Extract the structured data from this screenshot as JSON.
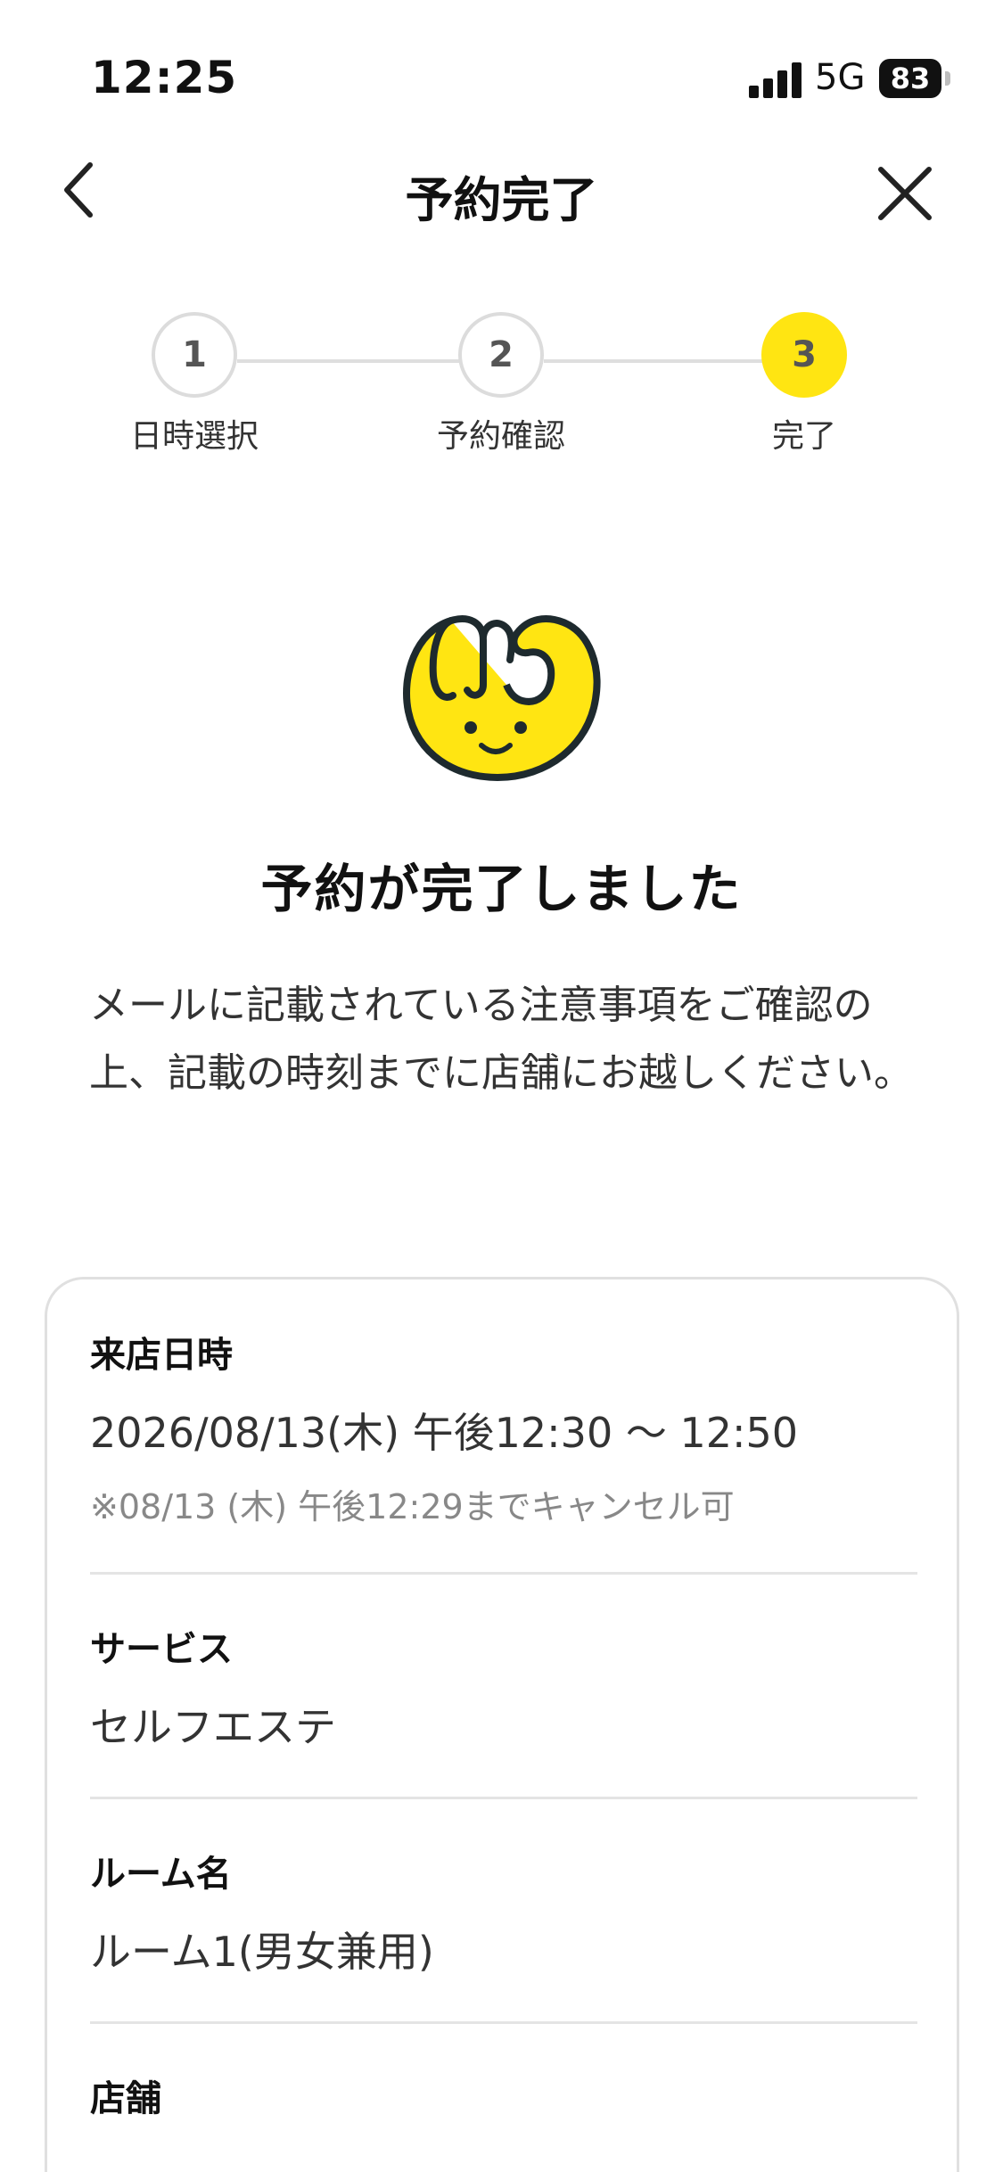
{
  "status_bar": {
    "time": "12:25",
    "network": "5G",
    "battery": "83"
  },
  "nav": {
    "title": "予約完了"
  },
  "stepper": {
    "steps": [
      {
        "number": "1",
        "label": "日時選択"
      },
      {
        "number": "2",
        "label": "予約確認"
      },
      {
        "number": "3",
        "label": "完了"
      }
    ],
    "active_step": 3,
    "active_color": "#FFE512"
  },
  "complete": {
    "title": "予約が完了しました",
    "message": "メールに記載されている注意事項をご確認の上、記載の時刻までに店舗にお越しください。"
  },
  "details": {
    "visit": {
      "label": "来店日時",
      "value": "2026/08/13(木) 午後12:30 〜 12:50",
      "note": "※08/13 (木) 午後12:29までキャンセル可"
    },
    "service": {
      "label": "サービス",
      "value": "セルフエステ"
    },
    "room": {
      "label": "ルーム名",
      "value": "ルーム1(男女兼用)"
    },
    "store": {
      "label": "店舗"
    }
  },
  "icons": {
    "back": "chevron-left-icon",
    "close": "close-icon",
    "mascot": "mascot-icon"
  }
}
